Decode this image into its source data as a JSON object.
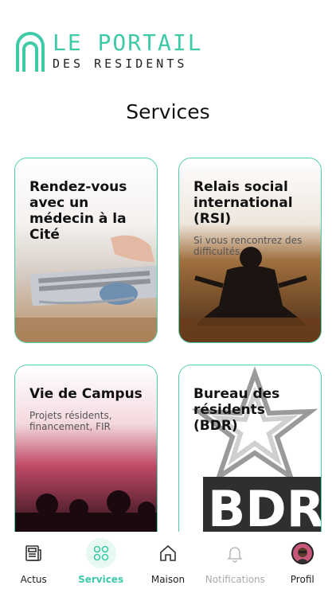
{
  "app": {
    "logo_line1": "LE PORTAIL",
    "logo_line2": "DES RESIDENTS",
    "accent_color": "#3ecaa7"
  },
  "page": {
    "title": "Services"
  },
  "cards": [
    {
      "title": "Rendez-vous avec un médecin à la Cité",
      "subtitle": "",
      "image": "doctor-laptop-stethoscope-photo"
    },
    {
      "title": "Relais social international (RSI)",
      "subtitle": "Si vous rencontrez des difficultés",
      "image": "meditation-silhouette-photo"
    },
    {
      "title": "Vie de Campus",
      "subtitle": "Projets résidents, financement, FIR",
      "image": "concert-crowd-photo"
    },
    {
      "title": "Bureau des résidents (BDR)",
      "subtitle": "",
      "image": "bdr-logo"
    }
  ],
  "nav": {
    "items": [
      {
        "label": "Actus",
        "icon": "newspaper-icon"
      },
      {
        "label": "Services",
        "icon": "grid-circles-icon"
      },
      {
        "label": "Maison",
        "icon": "house-icon"
      },
      {
        "label": "Notifications",
        "icon": "bell-icon"
      },
      {
        "label": "Profil",
        "icon": "avatar"
      }
    ],
    "active": "Services"
  }
}
